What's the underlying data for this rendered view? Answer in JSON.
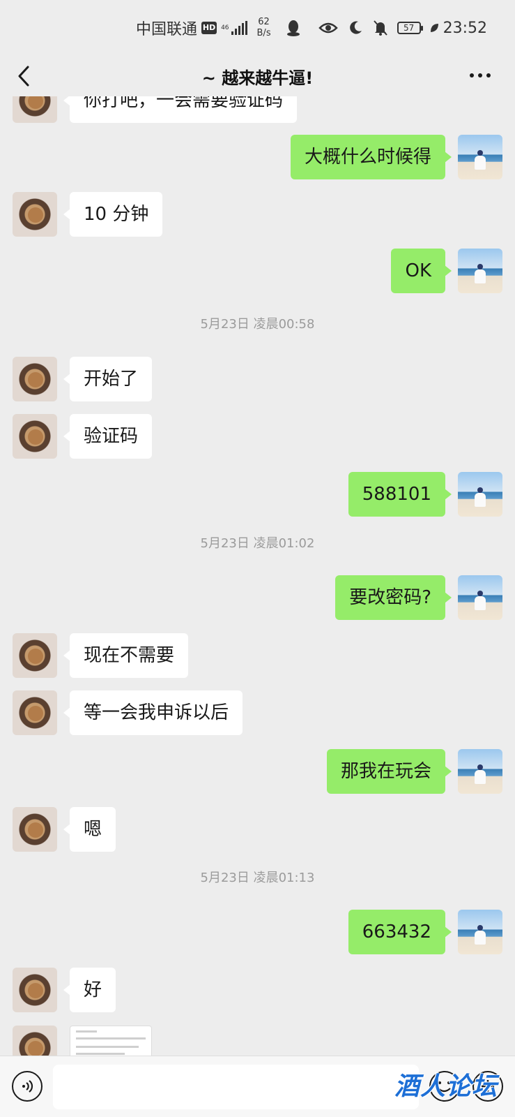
{
  "status_bar": {
    "carrier": "中国联通",
    "hd": "HD",
    "network": "46",
    "speed_value": "62",
    "speed_unit": "B/s",
    "battery": "57",
    "time": "23:52",
    "icons": [
      "qq-icon",
      "eye-icon",
      "moon-icon",
      "bell-mute-icon",
      "battery-icon",
      "leaf-icon"
    ]
  },
  "nav": {
    "title": "~ 越来越牛逼!",
    "back_icon": "chevron-left-icon",
    "more_icon": "ellipsis-icon"
  },
  "messages": [
    {
      "side": "left",
      "text": "你打吧，一会需要验证码"
    },
    {
      "side": "right",
      "text": "大概什么时候得"
    },
    {
      "side": "left",
      "text": "10 分钟"
    },
    {
      "side": "right",
      "text": "OK"
    },
    {
      "type": "timestamp",
      "text": "5月23日 凌晨00:58"
    },
    {
      "side": "left",
      "text": "开始了"
    },
    {
      "side": "left",
      "text": "验证码"
    },
    {
      "side": "right",
      "text": "588101"
    },
    {
      "type": "timestamp",
      "text": "5月23日 凌晨01:02"
    },
    {
      "side": "right",
      "text": "要改密码?"
    },
    {
      "side": "left",
      "text": "现在不需要"
    },
    {
      "side": "left",
      "text": "等一会我申诉以后"
    },
    {
      "side": "right",
      "text": "那我在玩会"
    },
    {
      "side": "left",
      "text": "嗯"
    },
    {
      "type": "timestamp",
      "text": "5月23日 凌晨01:13"
    },
    {
      "side": "right",
      "text": "663432"
    },
    {
      "side": "left",
      "text": "好"
    },
    {
      "side": "left",
      "type": "image"
    }
  ],
  "input_bar": {
    "value": "",
    "watermark": "酒人论坛"
  },
  "colors": {
    "background": "#ededed",
    "bubble_self": "#95ec69",
    "bubble_other": "#ffffff",
    "timestamp": "#9b9b9b"
  }
}
